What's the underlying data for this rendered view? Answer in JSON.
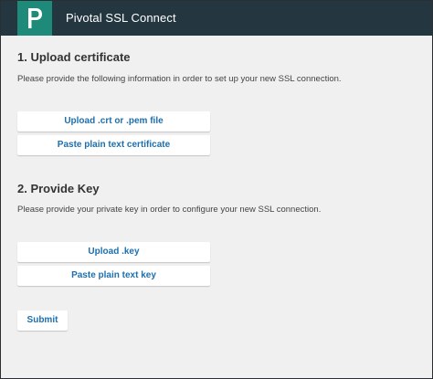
{
  "app": {
    "title": "Pivotal SSL Connect",
    "logo_letter": "P",
    "brand_color": "#1d8a7a",
    "header_color": "#243640"
  },
  "sections": [
    {
      "title": "1. Upload certificate",
      "description": "Please provide the following information in order to set up your new SSL connection.",
      "buttons": [
        "Upload .crt or .pem file",
        "Paste plain text certificate"
      ]
    },
    {
      "title": "2. Provide Key",
      "description": "Please provide your private key in order to configure your new SSL connection.",
      "buttons": [
        "Upload .key",
        "Paste plain text key"
      ]
    }
  ],
  "submit_label": "Submit",
  "accent_color": "#1d6fae"
}
